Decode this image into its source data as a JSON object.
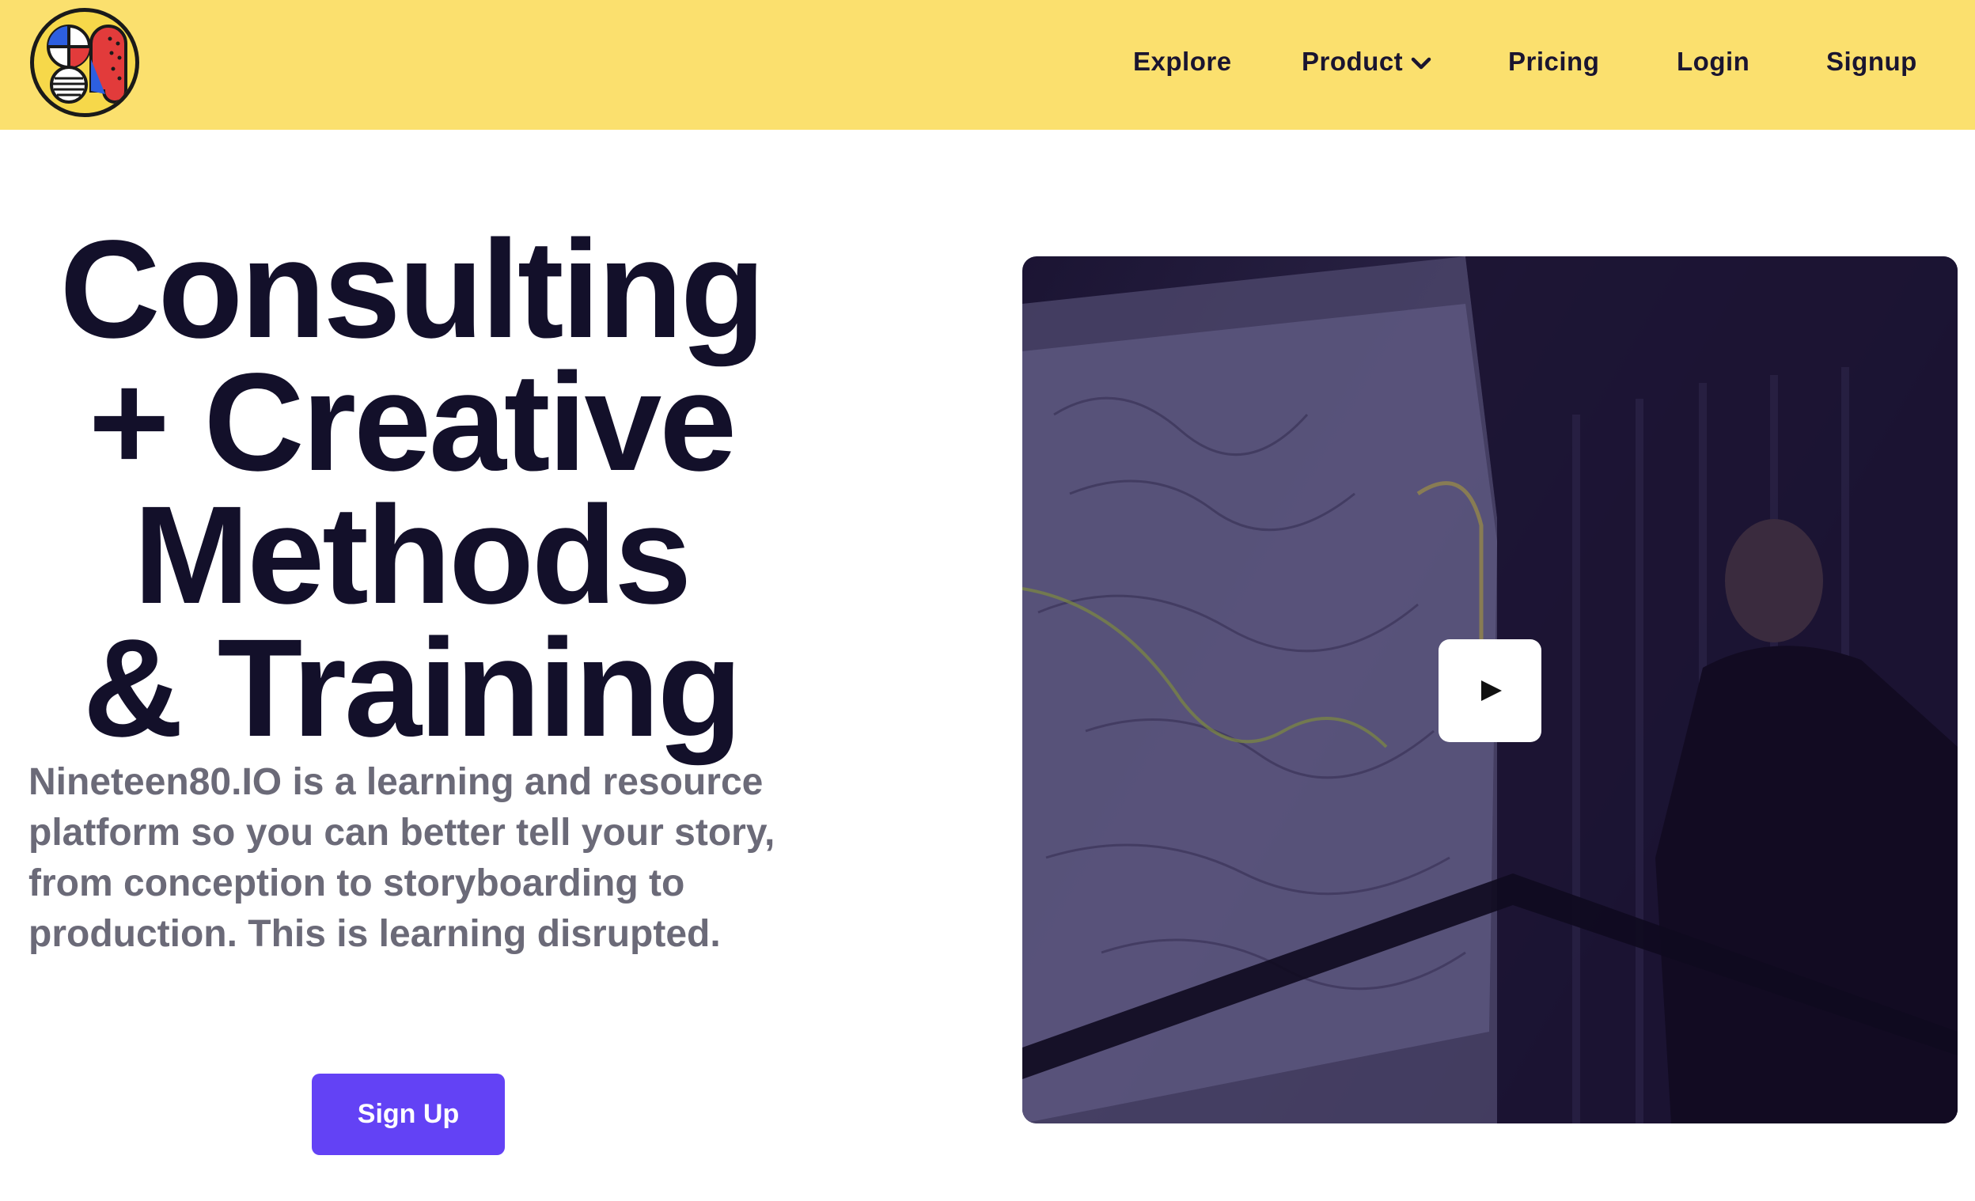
{
  "header": {
    "logo_name": "nineteen80-logo",
    "nav": {
      "explore": "Explore",
      "product": "Product",
      "pricing": "Pricing",
      "login": "Login",
      "signup": "Signup"
    },
    "background_color": "#fbe06e"
  },
  "hero": {
    "headline_lines": [
      "Consulting",
      "+ Creative",
      "Methods",
      "& Training"
    ],
    "description": "Nineteen80.IO is a learning and resource platform so you can better tell your story, from conception to storyboarding to production. This is learning disrupted.",
    "cta_label": "Sign Up",
    "cta_color": "#6342f5"
  },
  "video": {
    "play_icon": "play-icon"
  }
}
